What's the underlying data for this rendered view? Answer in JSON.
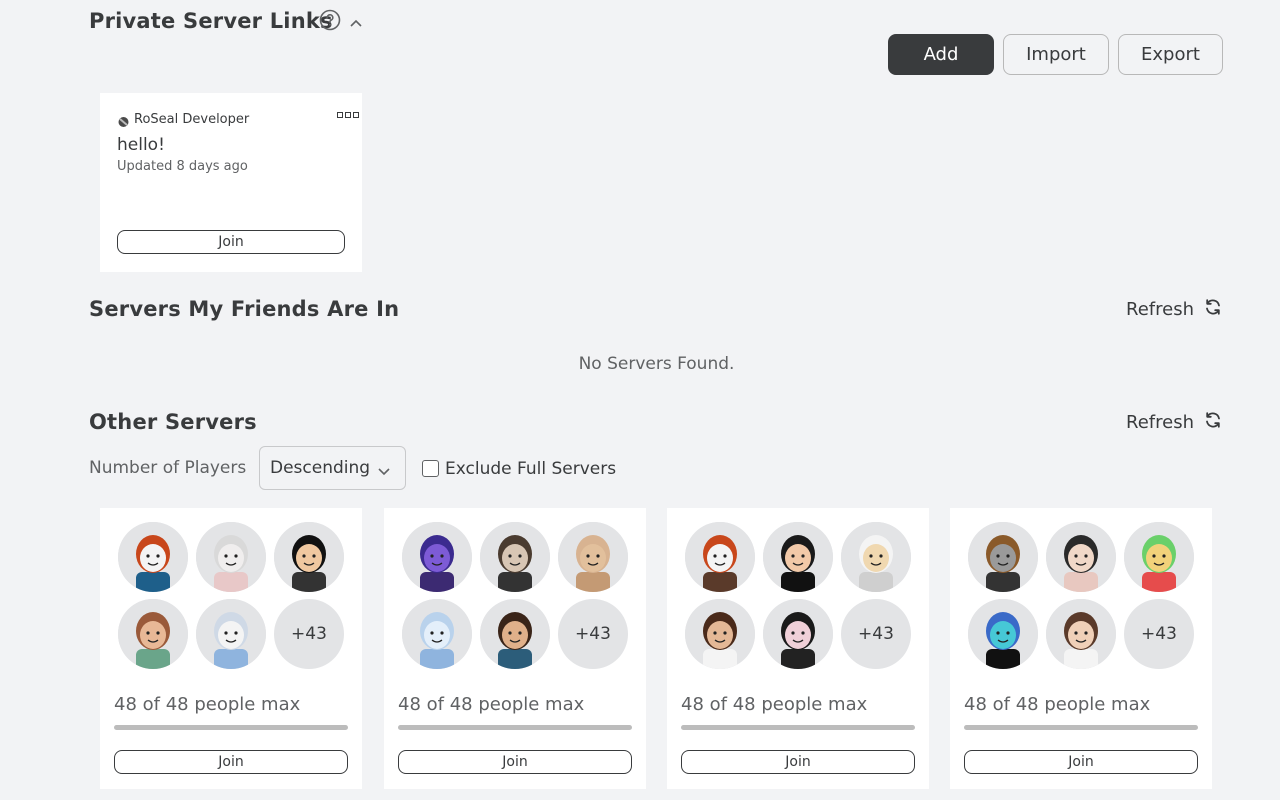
{
  "private_links": {
    "title": "Private Server Links",
    "help_icon": "question-circle-icon",
    "collapse_icon": "chevron-up-icon",
    "buttons": {
      "add": "Add",
      "import": "Import",
      "export": "Export"
    },
    "card": {
      "owner": "RoSeal Developer",
      "name": "hello!",
      "updated": "Updated 8 days ago",
      "join": "Join",
      "menu_icon": "more-dots-icon"
    }
  },
  "friends_servers": {
    "title": "Servers My Friends Are In",
    "refresh": "Refresh",
    "empty": "No Servers Found."
  },
  "other_servers": {
    "title": "Other Servers",
    "refresh": "Refresh",
    "sort_label": "Number of Players",
    "sort_value": "Descending",
    "exclude_label": "Exclude Full Servers",
    "exclude_checked": false
  },
  "servers": [
    {
      "more": "+43",
      "players": "48 of 48 people max",
      "fill": 1.0,
      "join": "Join"
    },
    {
      "more": "+43",
      "players": "48 of 48 people max",
      "fill": 1.0,
      "join": "Join"
    },
    {
      "more": "+43",
      "players": "48 of 48 people max",
      "fill": 1.0,
      "join": "Join"
    },
    {
      "more": "+43",
      "players": "48 of 48 people max",
      "fill": 1.0,
      "join": "Join"
    }
  ],
  "colors": {
    "accent_dark": "#393b3d",
    "page_bg": "#f2f3f5"
  }
}
